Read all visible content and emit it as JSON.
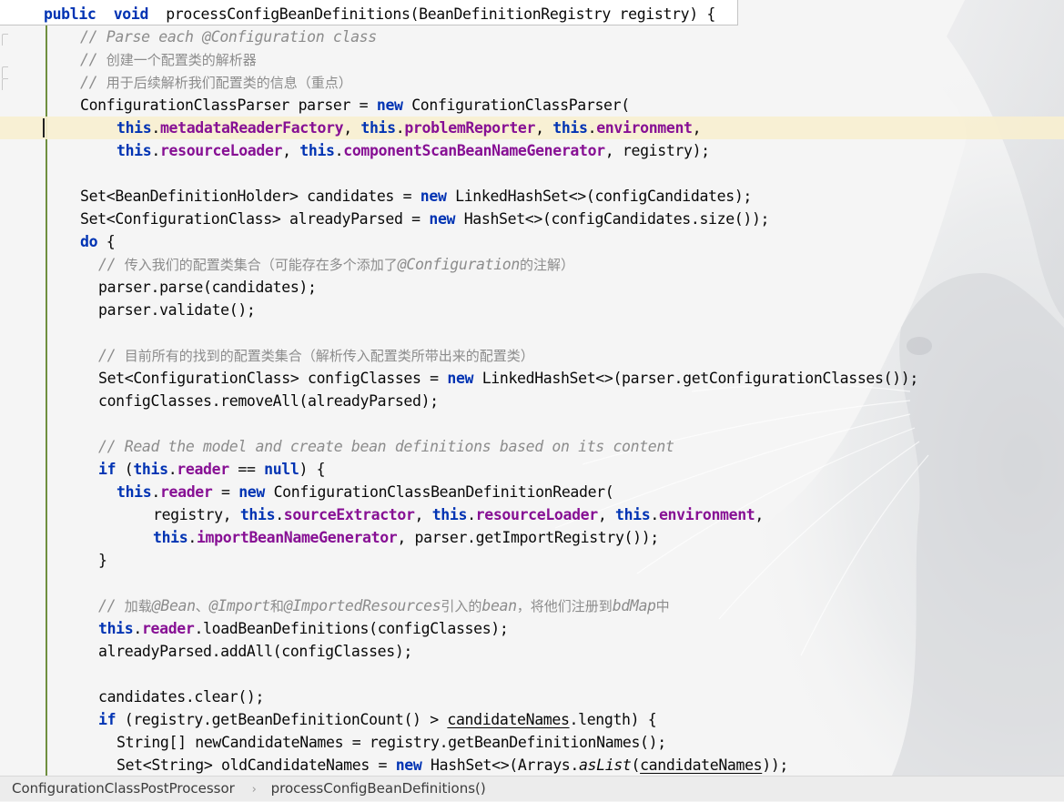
{
  "editor": {
    "highlighted_line": 4,
    "header_line": 0,
    "lines": [
      {
        "indent": 0,
        "tokens": [
          [
            "kw",
            "public"
          ],
          [
            "",
            "  "
          ],
          [
            "kw",
            "void"
          ],
          [
            "",
            "  processConfigBeanDefinitions(BeanDefinitionRegistry registry) {"
          ]
        ]
      },
      {
        "indent": 8,
        "tokens": [
          [
            "cm",
            "// Parse each @Configuration class"
          ]
        ]
      },
      {
        "indent": 8,
        "tokens": [
          [
            "cm",
            "// "
          ],
          [
            "cmzh",
            "创建一个配置类的解析器"
          ]
        ]
      },
      {
        "indent": 8,
        "tokens": [
          [
            "cm",
            "// "
          ],
          [
            "cmzh",
            "用于后续解析我们配置类的信息（重点）"
          ]
        ]
      },
      {
        "indent": 8,
        "tokens": [
          [
            "",
            "ConfigurationClassParser parser = "
          ],
          [
            "kw",
            "new"
          ],
          [
            "",
            " ConfigurationClassParser("
          ]
        ]
      },
      {
        "indent": 16,
        "tokens": [
          [
            "kw",
            "this"
          ],
          [
            "",
            "."
          ],
          [
            "fld",
            "metadataReaderFactory"
          ],
          [
            "",
            ", "
          ],
          [
            "kw",
            "this"
          ],
          [
            "",
            "."
          ],
          [
            "fld",
            "problemReporter"
          ],
          [
            "",
            ", "
          ],
          [
            "kw",
            "this"
          ],
          [
            "",
            "."
          ],
          [
            "fld",
            "environment"
          ],
          [
            "",
            ","
          ]
        ]
      },
      {
        "indent": 16,
        "tokens": [
          [
            "kw",
            "this"
          ],
          [
            "",
            "."
          ],
          [
            "fld",
            "resourceLoader"
          ],
          [
            "",
            ", "
          ],
          [
            "kw",
            "this"
          ],
          [
            "",
            "."
          ],
          [
            "fld",
            "componentScanBeanNameGenerator"
          ],
          [
            "",
            ", registry);"
          ]
        ]
      },
      {
        "indent": 0,
        "tokens": []
      },
      {
        "indent": 8,
        "tokens": [
          [
            "",
            "Set<BeanDefinitionHolder> candidates = "
          ],
          [
            "kw",
            "new"
          ],
          [
            "",
            " LinkedHashSet<>(configCandidates);"
          ]
        ]
      },
      {
        "indent": 8,
        "tokens": [
          [
            "",
            "Set<ConfigurationClass> alreadyParsed = "
          ],
          [
            "kw",
            "new"
          ],
          [
            "",
            " HashSet<>(configCandidates.size());"
          ]
        ]
      },
      {
        "indent": 8,
        "tokens": [
          [
            "kw",
            "do"
          ],
          [
            "",
            " {"
          ]
        ]
      },
      {
        "indent": 12,
        "tokens": [
          [
            "cm",
            "// "
          ],
          [
            "cmzh",
            "传入我们的配置类集合（可能存在多个添加了"
          ],
          [
            "cm",
            "@Configuration"
          ],
          [
            "cmzh",
            "的注解）"
          ]
        ]
      },
      {
        "indent": 12,
        "tokens": [
          [
            "",
            "parser.parse(candidates);"
          ]
        ]
      },
      {
        "indent": 12,
        "tokens": [
          [
            "",
            "parser.validate();"
          ]
        ]
      },
      {
        "indent": 0,
        "tokens": []
      },
      {
        "indent": 12,
        "tokens": [
          [
            "cm",
            "// "
          ],
          [
            "cmzh",
            "目前所有的找到的配置类集合（解析传入配置类所带出来的配置类）"
          ]
        ]
      },
      {
        "indent": 12,
        "tokens": [
          [
            "",
            "Set<ConfigurationClass> configClasses = "
          ],
          [
            "kw",
            "new"
          ],
          [
            "",
            " LinkedHashSet<>(parser.getConfigurationClasses());"
          ]
        ]
      },
      {
        "indent": 12,
        "tokens": [
          [
            "",
            "configClasses.removeAll(alreadyParsed);"
          ]
        ]
      },
      {
        "indent": 0,
        "tokens": []
      },
      {
        "indent": 12,
        "tokens": [
          [
            "cm",
            "// Read the model and create bean definitions based on its content"
          ]
        ]
      },
      {
        "indent": 12,
        "tokens": [
          [
            "kw",
            "if"
          ],
          [
            "",
            " ("
          ],
          [
            "kw",
            "this"
          ],
          [
            "",
            "."
          ],
          [
            "fld",
            "reader"
          ],
          [
            "",
            " == "
          ],
          [
            "kw",
            "null"
          ],
          [
            "",
            ") {"
          ]
        ]
      },
      {
        "indent": 16,
        "tokens": [
          [
            "kw",
            "this"
          ],
          [
            "",
            "."
          ],
          [
            "fld",
            "reader"
          ],
          [
            "",
            " = "
          ],
          [
            "kw",
            "new"
          ],
          [
            "",
            " ConfigurationClassBeanDefinitionReader("
          ]
        ]
      },
      {
        "indent": 24,
        "tokens": [
          [
            "",
            "registry, "
          ],
          [
            "kw",
            "this"
          ],
          [
            "",
            "."
          ],
          [
            "fld",
            "sourceExtractor"
          ],
          [
            "",
            ", "
          ],
          [
            "kw",
            "this"
          ],
          [
            "",
            "."
          ],
          [
            "fld",
            "resourceLoader"
          ],
          [
            "",
            ", "
          ],
          [
            "kw",
            "this"
          ],
          [
            "",
            "."
          ],
          [
            "fld",
            "environment"
          ],
          [
            "",
            ","
          ]
        ]
      },
      {
        "indent": 24,
        "tokens": [
          [
            "kw",
            "this"
          ],
          [
            "",
            "."
          ],
          [
            "fld",
            "importBeanNameGenerator"
          ],
          [
            "",
            ", parser.getImportRegistry());"
          ]
        ]
      },
      {
        "indent": 12,
        "tokens": [
          [
            "",
            "}"
          ]
        ]
      },
      {
        "indent": 0,
        "tokens": []
      },
      {
        "indent": 12,
        "tokens": [
          [
            "cm",
            "// "
          ],
          [
            "cmzh",
            "加载"
          ],
          [
            "cm",
            "@Bean"
          ],
          [
            "cmzh",
            "、"
          ],
          [
            "cm",
            "@Import"
          ],
          [
            "cmzh",
            "和"
          ],
          [
            "cm",
            "@ImportedResources"
          ],
          [
            "cmzh",
            "引入的"
          ],
          [
            "cm",
            "bean"
          ],
          [
            "cmzh",
            "，将他们注册到"
          ],
          [
            "cm",
            "bdMap"
          ],
          [
            "cmzh",
            "中"
          ]
        ]
      },
      {
        "indent": 12,
        "tokens": [
          [
            "kw",
            "this"
          ],
          [
            "",
            "."
          ],
          [
            "fld",
            "reader"
          ],
          [
            "",
            ".loadBeanDefinitions(configClasses);"
          ]
        ]
      },
      {
        "indent": 12,
        "tokens": [
          [
            "",
            "alreadyParsed.addAll(configClasses);"
          ]
        ]
      },
      {
        "indent": 0,
        "tokens": []
      },
      {
        "indent": 12,
        "tokens": [
          [
            "",
            "candidates.clear();"
          ]
        ]
      },
      {
        "indent": 12,
        "tokens": [
          [
            "kw",
            "if"
          ],
          [
            "",
            " (registry.getBeanDefinitionCount() > "
          ],
          [
            "ul",
            "candidateNames"
          ],
          [
            "",
            ".length) {"
          ]
        ]
      },
      {
        "indent": 16,
        "tokens": [
          [
            "",
            "String[] newCandidateNames = registry.getBeanDefinitionNames();"
          ]
        ]
      },
      {
        "indent": 16,
        "tokens": [
          [
            "",
            "Set<String> oldCandidateNames = "
          ],
          [
            "kw",
            "new"
          ],
          [
            "",
            " HashSet<>(Arrays."
          ],
          [
            "st",
            "asList"
          ],
          [
            "",
            "("
          ],
          [
            "ul",
            "candidateNames"
          ],
          [
            "",
            "));"
          ]
        ]
      }
    ]
  },
  "breadcrumb": {
    "class_name": "ConfigurationClassPostProcessor",
    "separator": "›",
    "method_name": "processConfigBeanDefinitions()"
  },
  "theme": {
    "keyword": "#0033b3",
    "field": "#871094",
    "comment": "#8c8c8c",
    "text": "#080808",
    "line_highlight": "#f7efd0",
    "gutter_change": "#6f8f3f"
  },
  "background_art": "cat-silhouette-watermark"
}
